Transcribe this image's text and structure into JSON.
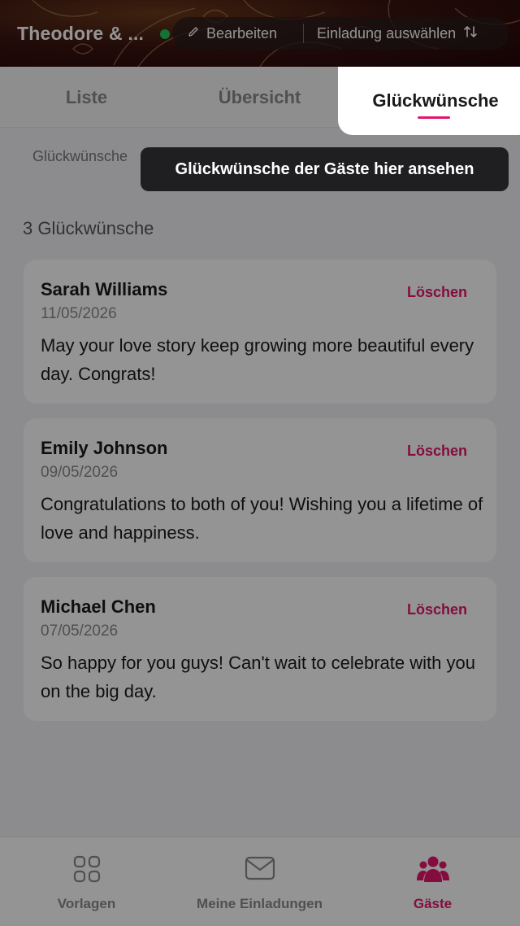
{
  "header": {
    "event_title": "Theodore & ...",
    "edit_label": "Bearbeiten",
    "select_invitation_label": "Einladung auswählen",
    "status_color": "#22c55e"
  },
  "tabs": [
    {
      "label": "Liste",
      "active": false
    },
    {
      "label": "Übersicht",
      "active": false
    },
    {
      "label": "Glückwünsche",
      "active": true
    }
  ],
  "wishes_hint": "Glückwünsche",
  "tooltip": "Glückwünsche der Gäste hier ansehen",
  "wishes_count_label": "3 Glückwünsche",
  "wishes": [
    {
      "name": "Sarah Williams",
      "date": "11/05/2026",
      "message": "May your love story keep growing more beautiful every day. Congrats!",
      "delete_label": "Löschen"
    },
    {
      "name": "Emily Johnson",
      "date": "09/05/2026",
      "message": "Congratulations to both of you! Wishing you a lifetime of love and happiness.",
      "delete_label": "Löschen"
    },
    {
      "name": "Michael Chen",
      "date": "07/05/2026",
      "message": "So happy for you guys! Can't wait to celebrate with you on the big day.",
      "delete_label": "Löschen"
    }
  ],
  "bottom_nav": [
    {
      "label": "Vorlagen",
      "icon": "grid-icon",
      "active": false
    },
    {
      "label": "Meine Einladungen",
      "icon": "envelope-icon",
      "active": false
    },
    {
      "label": "Gäste",
      "icon": "guests-icon",
      "active": true
    }
  ],
  "colors": {
    "accent": "#e6156b",
    "tooltip_bg": "#1f1f21"
  }
}
